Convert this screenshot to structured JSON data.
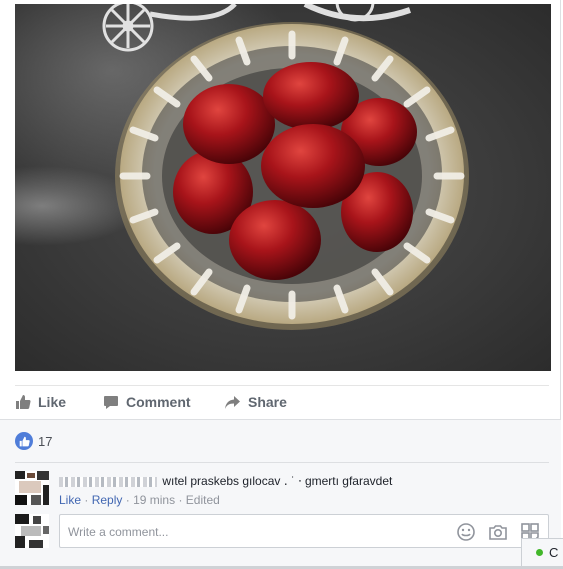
{
  "post": {
    "actions": {
      "like_label": "Like",
      "comment_label": "Comment",
      "share_label": "Share"
    },
    "reactions": {
      "count": "17",
      "icon": "thumbs-up-icon"
    }
  },
  "comment": {
    "text": "wıtel praskebs gılocav ․ ˙ ⸱ gmertı gfaravdet",
    "like_link": "Like",
    "reply_link": "Reply",
    "time": "19 mins",
    "edited": "Edited",
    "separator": "·"
  },
  "composer": {
    "placeholder": "Write a comment...",
    "icons": [
      "emoji-icon",
      "camera-icon",
      "sticker-icon"
    ]
  },
  "chat": {
    "label": "C",
    "status_color": "#42b72a"
  },
  "colors": {
    "link": "#4267b2",
    "action_text": "#606770",
    "reaction_blue": "#4f7dd9"
  }
}
